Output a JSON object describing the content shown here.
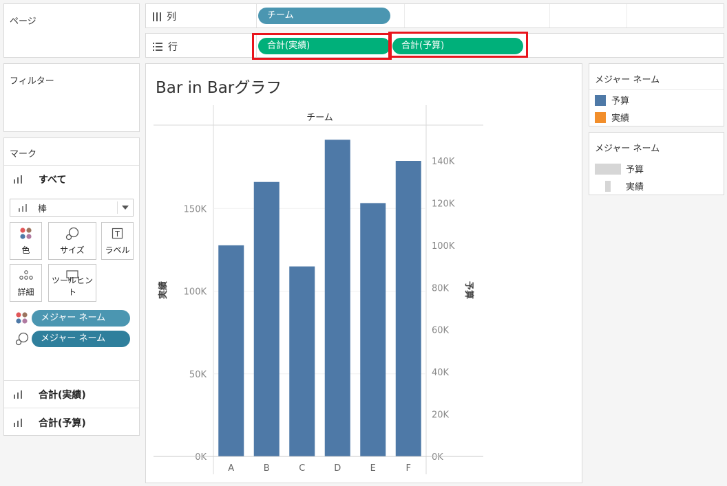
{
  "pages": {
    "title": "ページ"
  },
  "filters": {
    "title": "フィルター"
  },
  "columns_shelf": {
    "label": "列",
    "pills": [
      "チーム"
    ]
  },
  "rows_shelf": {
    "label": "行",
    "pills": [
      "合計(実績)",
      "合計(予算)"
    ]
  },
  "marks": {
    "title": "マーク",
    "cards": [
      "すべて",
      "合計(実績)",
      "合計(予算)"
    ],
    "mark_type": "棒",
    "buttons": {
      "color": "色",
      "size": "サイズ",
      "label": "ラベル",
      "detail": "詳細",
      "tooltip": "ツールヒント"
    },
    "fields": [
      "メジャー ネーム",
      "メジャー ネーム"
    ]
  },
  "legends": [
    {
      "title": "メジャー ネーム",
      "items": [
        {
          "label": "予算",
          "color": "#4e79a7"
        },
        {
          "label": "実績",
          "color": "#f28e2b"
        }
      ]
    },
    {
      "title": "メジャー ネーム",
      "items": [
        {
          "label": "予算"
        },
        {
          "label": "実績"
        }
      ]
    }
  ],
  "chart_data": {
    "type": "bar",
    "title": "Bar in Barグラフ",
    "column_header": "チーム",
    "categories": [
      "A",
      "B",
      "C",
      "D",
      "E",
      "F"
    ],
    "series": [
      {
        "name": "実績",
        "axis": "left",
        "values": [
          0,
          0,
          0,
          0,
          0,
          0
        ]
      },
      {
        "name": "予算",
        "axis": "right",
        "values": [
          100000,
          130000,
          90000,
          150000,
          120000,
          140000
        ]
      }
    ],
    "ylabel": "実績",
    "ylim": [
      0,
      200000
    ],
    "left_ticks": [
      0,
      50000,
      100000,
      150000
    ],
    "left_tick_labels": [
      "0K",
      "50K",
      "100K",
      "150K"
    ],
    "y2label": "予算",
    "y2lim": [
      0,
      140000
    ],
    "right_ticks": [
      0,
      20000,
      40000,
      60000,
      80000,
      100000,
      120000,
      140000
    ],
    "right_tick_labels": [
      "0K",
      "20K",
      "40K",
      "60K",
      "80K",
      "100K",
      "120K",
      "140K"
    ],
    "bar_color": "#4e79a7",
    "grid": true
  }
}
